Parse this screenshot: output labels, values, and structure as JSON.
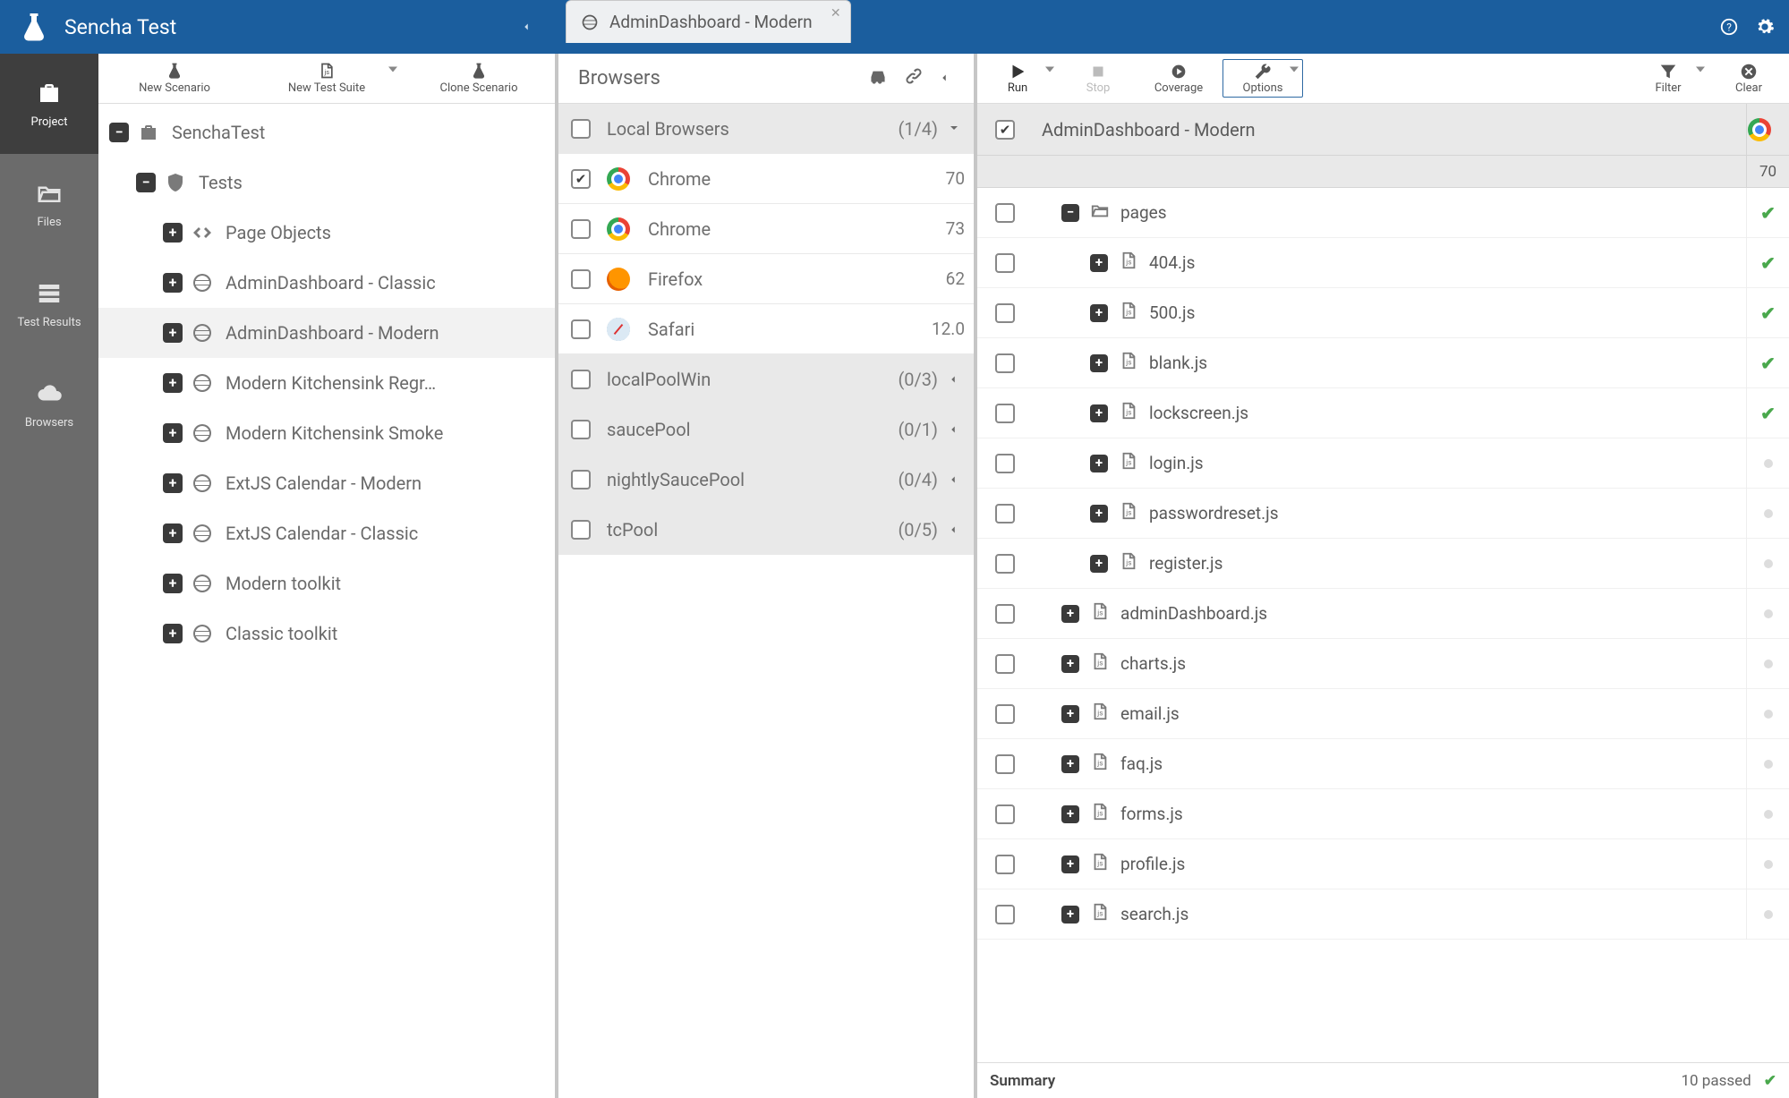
{
  "app": {
    "title": "Sencha Test"
  },
  "vnav": {
    "items": [
      {
        "label": "Project"
      },
      {
        "label": "Files"
      },
      {
        "label": "Test Results"
      },
      {
        "label": "Browsers"
      }
    ]
  },
  "project_toolbar": {
    "new_scenario": "New Scenario",
    "new_test_suite": "New Test Suite",
    "clone_scenario": "Clone Scenario"
  },
  "project_tree": [
    {
      "label": "SenchaTest",
      "indent": 0,
      "exp": "minus",
      "icon": "briefcase"
    },
    {
      "label": "Tests",
      "indent": 1,
      "exp": "minus",
      "icon": "shield"
    },
    {
      "label": "Page Objects",
      "indent": 2,
      "exp": "plus",
      "icon": "code"
    },
    {
      "label": "AdminDashboard - Classic",
      "indent": 2,
      "exp": "plus",
      "icon": "globe"
    },
    {
      "label": "AdminDashboard - Modern",
      "indent": 2,
      "exp": "plus",
      "icon": "globe",
      "selected": true
    },
    {
      "label": "Modern Kitchensink Regr…",
      "indent": 2,
      "exp": "plus",
      "icon": "globe"
    },
    {
      "label": "Modern Kitchensink Smoke",
      "indent": 2,
      "exp": "plus",
      "icon": "globe"
    },
    {
      "label": "ExtJS Calendar - Modern",
      "indent": 2,
      "exp": "plus",
      "icon": "globe"
    },
    {
      "label": "ExtJS Calendar - Classic",
      "indent": 2,
      "exp": "plus",
      "icon": "globe"
    },
    {
      "label": "Modern toolkit",
      "indent": 2,
      "exp": "plus",
      "icon": "globe"
    },
    {
      "label": "Classic toolkit",
      "indent": 2,
      "exp": "plus",
      "icon": "globe"
    }
  ],
  "tab": {
    "label": "AdminDashboard - Modern"
  },
  "browsers": {
    "header": "Browsers",
    "pools": [
      {
        "name": "Local Browsers",
        "count": "(1/4)",
        "expanded": true,
        "browsers": [
          {
            "name": "Chrome",
            "version": "70",
            "icon": "chrome",
            "checked": true
          },
          {
            "name": "Chrome",
            "version": "73",
            "icon": "chrome",
            "checked": false
          },
          {
            "name": "Firefox",
            "version": "62",
            "icon": "firefox",
            "checked": false
          },
          {
            "name": "Safari",
            "version": "12.0",
            "icon": "safari",
            "checked": false
          }
        ]
      },
      {
        "name": "localPoolWin",
        "count": "(0/3)",
        "expanded": false
      },
      {
        "name": "saucePool",
        "count": "(0/1)",
        "expanded": false
      },
      {
        "name": "nightlySaucePool",
        "count": "(0/4)",
        "expanded": false
      },
      {
        "name": "tcPool",
        "count": "(0/5)",
        "expanded": false
      }
    ]
  },
  "results_toolbar": {
    "run": "Run",
    "stop": "Stop",
    "coverage": "Coverage",
    "options": "Options",
    "filter": "Filter",
    "clear": "Clear"
  },
  "results": {
    "title": "AdminDashboard - Modern",
    "browser_col_version": "70",
    "rows": [
      {
        "label": "pages",
        "indent": 1,
        "exp": "minus",
        "icon": "folder",
        "status": "pass"
      },
      {
        "label": "404.js",
        "indent": 2,
        "exp": "plus",
        "icon": "file",
        "status": "pass"
      },
      {
        "label": "500.js",
        "indent": 2,
        "exp": "plus",
        "icon": "file",
        "status": "pass"
      },
      {
        "label": "blank.js",
        "indent": 2,
        "exp": "plus",
        "icon": "file",
        "status": "pass"
      },
      {
        "label": "lockscreen.js",
        "indent": 2,
        "exp": "plus",
        "icon": "file",
        "status": "pass"
      },
      {
        "label": "login.js",
        "indent": 2,
        "exp": "plus",
        "icon": "file",
        "status": "none"
      },
      {
        "label": "passwordreset.js",
        "indent": 2,
        "exp": "plus",
        "icon": "file",
        "status": "none"
      },
      {
        "label": "register.js",
        "indent": 2,
        "exp": "plus",
        "icon": "file",
        "status": "none"
      },
      {
        "label": "adminDashboard.js",
        "indent": 1,
        "exp": "plus",
        "icon": "file",
        "status": "none"
      },
      {
        "label": "charts.js",
        "indent": 1,
        "exp": "plus",
        "icon": "file",
        "status": "none"
      },
      {
        "label": "email.js",
        "indent": 1,
        "exp": "plus",
        "icon": "file",
        "status": "none"
      },
      {
        "label": "faq.js",
        "indent": 1,
        "exp": "plus",
        "icon": "file",
        "status": "none"
      },
      {
        "label": "forms.js",
        "indent": 1,
        "exp": "plus",
        "icon": "file",
        "status": "none"
      },
      {
        "label": "profile.js",
        "indent": 1,
        "exp": "plus",
        "icon": "file",
        "status": "none"
      },
      {
        "label": "search.js",
        "indent": 1,
        "exp": "plus",
        "icon": "file",
        "status": "none"
      }
    ],
    "summary_label": "Summary",
    "summary_passed": "10 passed"
  }
}
